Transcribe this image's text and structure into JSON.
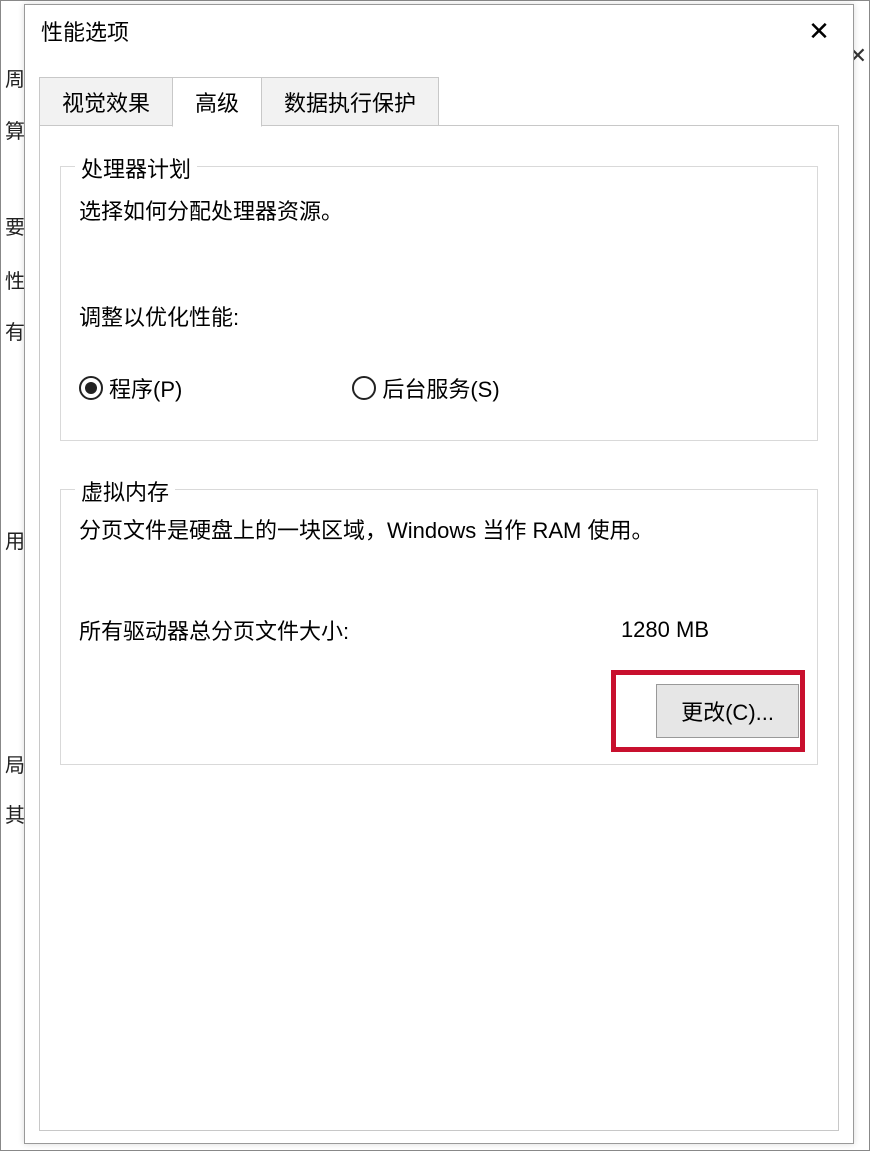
{
  "background": {
    "fragments": [
      "周",
      "算",
      "要",
      "性",
      "有",
      "用",
      "局",
      "其"
    ]
  },
  "dialog": {
    "title": "性能选项",
    "close_icon": "✕",
    "behind_close": "✕"
  },
  "tabs": {
    "visual_effects": "视觉效果",
    "advanced": "高级",
    "dep": "数据执行保护"
  },
  "processor": {
    "legend": "处理器计划",
    "desc": "选择如何分配处理器资源。",
    "adjust_label": "调整以优化性能:",
    "radio_programs": "程序(P)",
    "radio_background": "后台服务(S)"
  },
  "vm": {
    "legend": "虚拟内存",
    "desc": "分页文件是硬盘上的一块区域，Windows 当作 RAM 使用。",
    "total_label": "所有驱动器总分页文件大小:",
    "total_value": "1280 MB",
    "change_btn": "更改(C)..."
  }
}
